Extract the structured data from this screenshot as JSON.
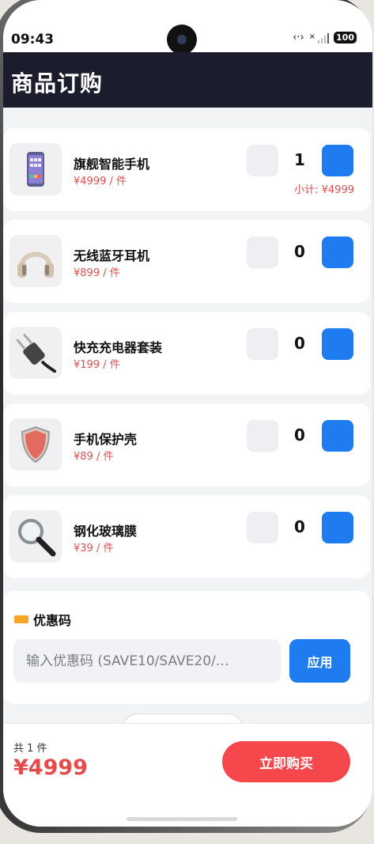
{
  "status_bar": {
    "time": "09:43",
    "network_label": "‹·›",
    "x_mark": "×",
    "battery": "100"
  },
  "header": {
    "title": "商品订购"
  },
  "products": [
    {
      "name": "旗舰智能手机",
      "price": "¥4999 / 件",
      "qty": "1",
      "subtotal": "小计: ¥4999",
      "icon": "smartphone-icon"
    },
    {
      "name": "无线蓝牙耳机",
      "price": "¥899 / 件",
      "qty": "0",
      "icon": "headphones-icon"
    },
    {
      "name": "快充充电器套装",
      "price": "¥199 / 件",
      "qty": "0",
      "icon": "plug-icon"
    },
    {
      "name": "手机保护壳",
      "price": "¥89 / 件",
      "qty": "0",
      "icon": "shield-icon"
    },
    {
      "name": "钢化玻璃膜",
      "price": "¥39 / 件",
      "qty": "0",
      "icon": "magnifier-icon"
    }
  ],
  "coupon": {
    "title": "优惠码",
    "placeholder": "输入优惠码 (SAVE10/SAVE20/…",
    "apply_label": "应用"
  },
  "footer": {
    "count_label": "共 1 件",
    "total": "¥4999",
    "buy_label": "立即购买"
  },
  "colors": {
    "accent": "#1f7bf0",
    "price": "#e54b4b",
    "buy": "#f5474c",
    "header_bg": "#1b1d2d"
  }
}
